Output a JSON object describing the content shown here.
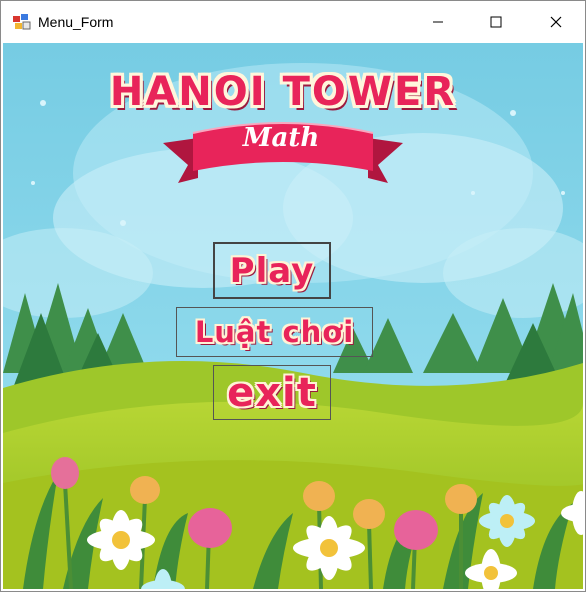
{
  "window": {
    "title": "Menu_Form"
  },
  "logo": {
    "title": "HANOI TOWER",
    "subtitle": "Math"
  },
  "menu": {
    "play_label": "Play",
    "rules_label": "Luật chơi",
    "exit_label": "exit"
  },
  "colors": {
    "accent": "#e8245a",
    "sky": "#7fd3ea",
    "grass": "#a6c824"
  }
}
